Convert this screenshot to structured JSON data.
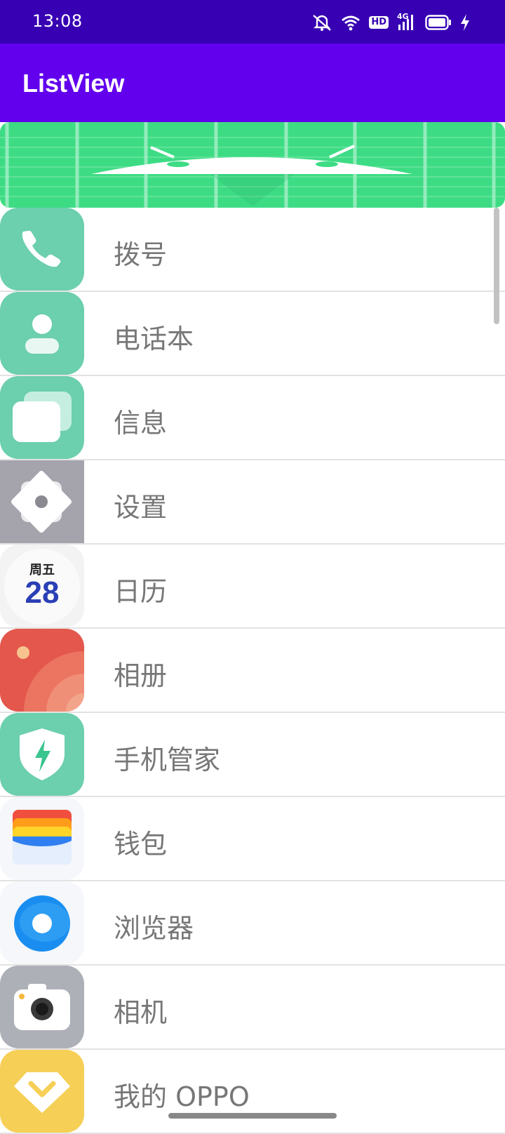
{
  "status_bar": {
    "time": "13:08",
    "icons": [
      "mute-icon",
      "wifi-icon",
      "hd-icon",
      "4g-signal-icon",
      "battery-icon",
      "charging-icon"
    ],
    "hd_label": "HD",
    "network_label": "4G",
    "background": "#3700b3"
  },
  "app_bar": {
    "title": "ListView",
    "background": "#6200ee"
  },
  "banner": {
    "image": "android-robot-head-banner",
    "background": "#3ddc84"
  },
  "list": {
    "items": [
      {
        "label": "拨号",
        "icon": "phone-icon",
        "color": "#6ccfae"
      },
      {
        "label": "电话本",
        "icon": "contacts-icon",
        "color": "#6ccfae"
      },
      {
        "label": "信息",
        "icon": "messages-icon",
        "color": "#6ccfae"
      },
      {
        "label": "设置",
        "icon": "settings-icon",
        "color": "#a5a4ad"
      },
      {
        "label": "日历",
        "icon": "calendar-icon",
        "color": "#f3f3f3"
      },
      {
        "label": "相册",
        "icon": "gallery-icon",
        "color": "#e3574d"
      },
      {
        "label": "手机管家",
        "icon": "phone-manager-icon",
        "color": "#6ccfae"
      },
      {
        "label": "钱包",
        "icon": "wallet-icon",
        "color": "#f5f7fb"
      },
      {
        "label": "浏览器",
        "icon": "browser-icon",
        "color": "#f5f7fb"
      },
      {
        "label": "相机",
        "icon": "camera-icon",
        "color": "#aeb0b8"
      },
      {
        "label": "我的 OPPO",
        "icon": "my-oppo-icon",
        "color": "#f6cf56"
      }
    ],
    "calendar_icon": {
      "weekday": "周五",
      "day": "28"
    }
  }
}
